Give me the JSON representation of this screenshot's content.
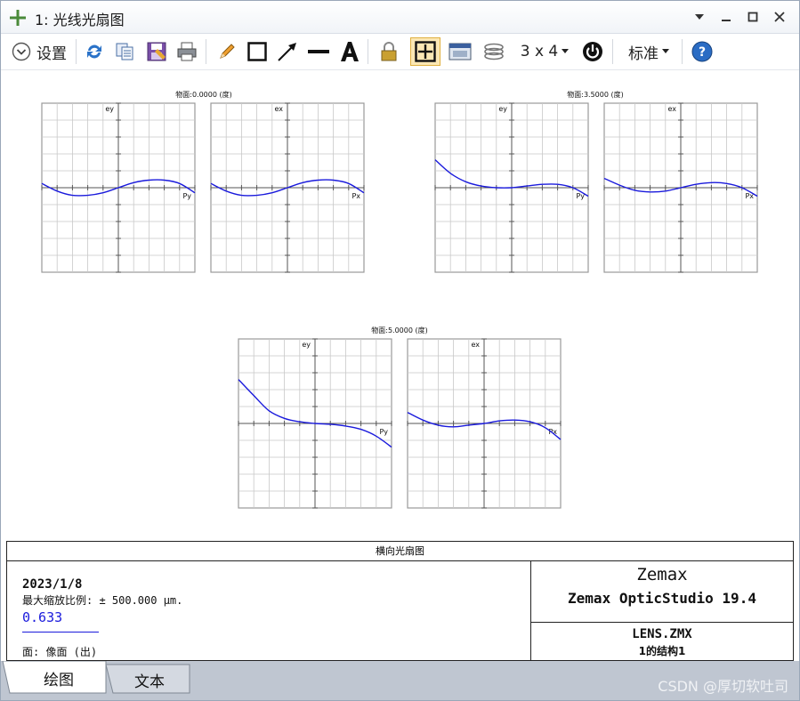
{
  "window": {
    "title": "1: 光线光扇图"
  },
  "toolbar": {
    "settings_label": "设置",
    "layout_label": "3 x 4",
    "style_label": "标准"
  },
  "plots": {
    "groups": [
      {
        "caption": "物面:0.0000 (度)",
        "tangential": {
          "ylabel": "ey",
          "xlabel": "Py"
        },
        "sagittal": {
          "ylabel": "ex",
          "xlabel": "Px"
        }
      },
      {
        "caption": "物面:3.5000 (度)",
        "tangential": {
          "ylabel": "ey",
          "xlabel": "Py"
        },
        "sagittal": {
          "ylabel": "ex",
          "xlabel": "Px"
        }
      },
      {
        "caption": "物面:5.0000 (度)",
        "tangential": {
          "ylabel": "ey",
          "xlabel": "Py"
        },
        "sagittal": {
          "ylabel": "ex",
          "xlabel": "Px"
        }
      }
    ],
    "curve_color": "#1a1adc"
  },
  "chart_data": {
    "type": "line",
    "x": [
      -1.0,
      -0.8,
      -0.6,
      -0.4,
      -0.2,
      0.0,
      0.2,
      0.4,
      0.6,
      0.8,
      1.0
    ],
    "xlim": [
      -1,
      1
    ],
    "ylim": [
      -1,
      1
    ],
    "grid": true,
    "panels": [
      {
        "field": "物面:0.0000 (度)",
        "axis": "ey",
        "values": [
          0.05,
          -0.04,
          -0.09,
          -0.09,
          -0.06,
          0.0,
          0.06,
          0.09,
          0.09,
          0.05,
          -0.06
        ]
      },
      {
        "field": "物面:0.0000 (度)",
        "axis": "ex",
        "values": [
          0.05,
          -0.04,
          -0.09,
          -0.09,
          -0.06,
          0.0,
          0.06,
          0.09,
          0.09,
          0.05,
          -0.06
        ]
      },
      {
        "field": "物面:3.5000 (度)",
        "axis": "ey",
        "values": [
          0.33,
          0.17,
          0.07,
          0.02,
          0.0,
          0.0,
          0.02,
          0.04,
          0.04,
          0.0,
          -0.1
        ]
      },
      {
        "field": "物面:3.5000 (度)",
        "axis": "ex",
        "values": [
          0.11,
          0.03,
          -0.03,
          -0.05,
          -0.04,
          0.0,
          0.04,
          0.06,
          0.05,
          0.0,
          -0.1
        ]
      },
      {
        "field": "物面:5.0000 (度)",
        "axis": "ey",
        "values": [
          0.52,
          0.33,
          0.15,
          0.06,
          0.02,
          0.0,
          -0.01,
          -0.03,
          -0.07,
          -0.15,
          -0.28
        ]
      },
      {
        "field": "物面:5.0000 (度)",
        "axis": "ex",
        "values": [
          0.13,
          0.04,
          -0.02,
          -0.04,
          -0.02,
          0.0,
          0.03,
          0.04,
          0.02,
          -0.05,
          -0.19
        ]
      }
    ]
  },
  "footer": {
    "title": "横向光扇图",
    "date": "2023/1/8",
    "scale": "最大缩放比例: ± 500.000 µm.",
    "wavelength": "0.633",
    "surface": "面: 像面 (出)",
    "brand": "Zemax",
    "product": "Zemax OpticStudio 19.4",
    "file": "LENS.ZMX",
    "config": "1的结构1"
  },
  "tabs": [
    {
      "label": "绘图",
      "active": true
    },
    {
      "label": "文本",
      "active": false
    }
  ],
  "watermark": "CSDN @厚切软吐司"
}
